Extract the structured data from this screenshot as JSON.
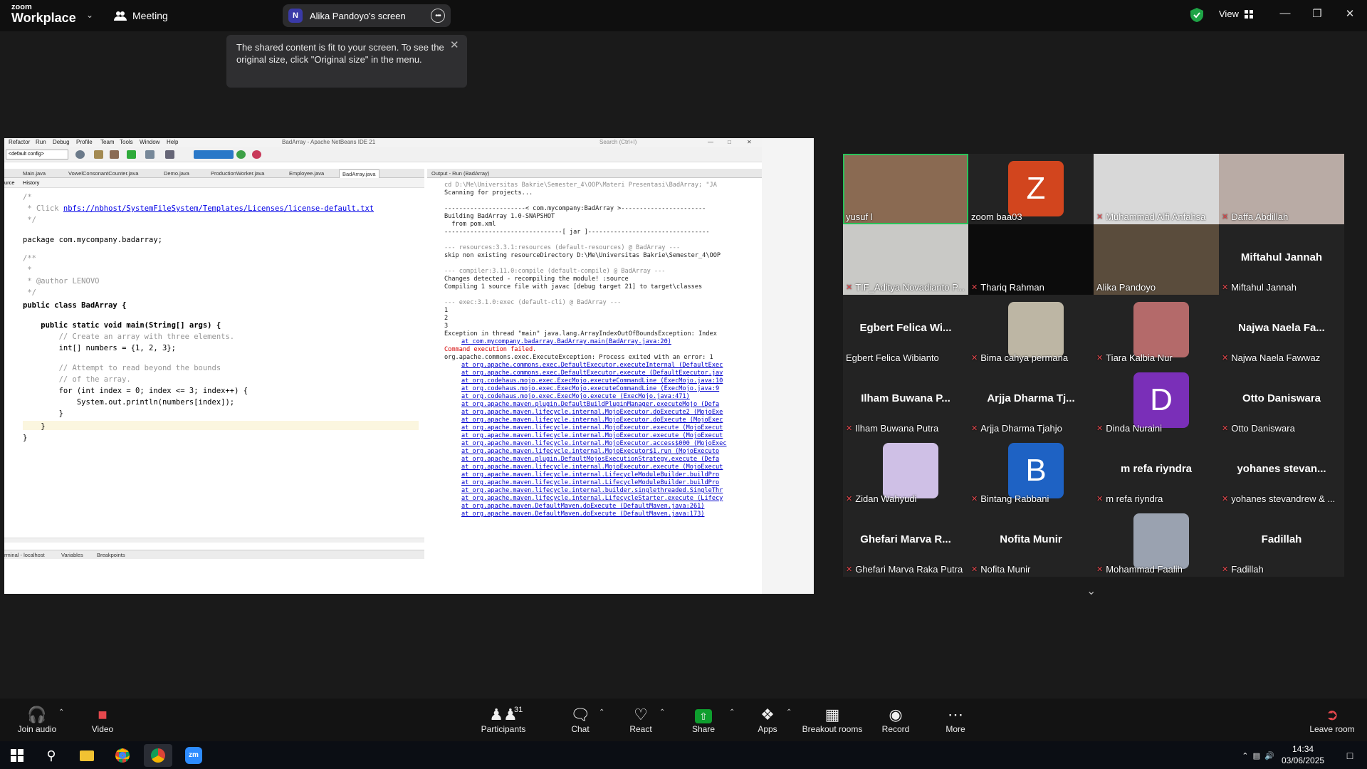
{
  "app": {
    "logo_line1": "zoom",
    "logo_line2": "Workplace",
    "meeting_label": "Meeting",
    "share_initial": "N",
    "share_title": "Alika Pandoyo's screen",
    "view_label": "View"
  },
  "toast": {
    "text": "The shared content is fit to your screen. To see the original size, click \"Original size\" in the menu."
  },
  "ide": {
    "title": "BadArray - Apache NetBeans IDE 21",
    "search_placeholder": "Search (Ctrl+I)",
    "menu": [
      "Refactor",
      "Run",
      "Debug",
      "Profile",
      "Team",
      "Tools",
      "Window",
      "Help"
    ],
    "config": "<default config>",
    "tabs": [
      "Main.java",
      "VowelConsonantCounter.java",
      "Demo.java",
      "ProductionWorker.java",
      "Employee.java",
      "BadArray.java"
    ],
    "active_tab": "BadArray.java",
    "editor_subtabs": [
      "urce",
      "History"
    ],
    "code_lines": [
      {
        "kind": "comment",
        "text": "/*"
      },
      {
        "kind": "comment-link",
        "prefix": " * Click ",
        "link": "nbfs://nbhost/SystemFileSystem/Templates/Licenses/license-default.txt"
      },
      {
        "kind": "comment",
        "text": " */"
      },
      {
        "kind": "plain",
        "text": "package com.mycompany.badarray;"
      },
      {
        "kind": "comment",
        "text": "/**"
      },
      {
        "kind": "comment",
        "text": " *"
      },
      {
        "kind": "comment",
        "text": " * @author LENOVO"
      },
      {
        "kind": "comment",
        "text": " */"
      },
      {
        "kind": "class",
        "text": "public class BadArray {"
      },
      {
        "kind": "method",
        "text": "    public static void main(String[] args) {"
      },
      {
        "kind": "comment",
        "text": "        // Create an array with three elements."
      },
      {
        "kind": "plain",
        "text": "        int[] numbers = {1, 2, 3};"
      },
      {
        "kind": "comment",
        "text": "        // Attempt to read beyond the bounds"
      },
      {
        "kind": "comment",
        "text": "        // of the array."
      },
      {
        "kind": "plain",
        "text": "        for (int index = 0; index <= 3; index++) {"
      },
      {
        "kind": "plain",
        "text": "            System.out.println(numbers[index]);"
      },
      {
        "kind": "plain",
        "text": "        }"
      },
      {
        "kind": "plain",
        "text": "    }"
      },
      {
        "kind": "plain",
        "text": "}"
      }
    ],
    "bottom_tabs": [
      "rminal - localhost",
      "Variables",
      "Breakpoints"
    ],
    "output_title": "Output - Run (BadArray)",
    "output_lines": [
      {
        "t": "g",
        "text": "cd D:\\Me\\Universitas Bakrie\\Semester_4\\OOP\\Materi Presentasi\\BadArray; \"JA"
      },
      {
        "t": "n",
        "text": "Scanning for projects..."
      },
      {
        "t": "n",
        "text": ""
      },
      {
        "t": "n",
        "text": "----------------------< com.mycompany:BadArray >-----------------------"
      },
      {
        "t": "n",
        "text": "Building BadArray 1.0-SNAPSHOT"
      },
      {
        "t": "n",
        "text": "  from pom.xml"
      },
      {
        "t": "n",
        "text": "--------------------------------[ jar ]---------------------------------"
      },
      {
        "t": "n",
        "text": ""
      },
      {
        "t": "g",
        "text": "--- resources:3.3.1:resources (default-resources) @ BadArray ---"
      },
      {
        "t": "n",
        "text": "skip non existing resourceDirectory D:\\Me\\Universitas Bakrie\\Semester_4\\OOP"
      },
      {
        "t": "n",
        "text": ""
      },
      {
        "t": "g",
        "text": "--- compiler:3.11.0:compile (default-compile) @ BadArray ---"
      },
      {
        "t": "n",
        "text": "Changes detected - recompiling the module! :source"
      },
      {
        "t": "n",
        "text": "Compiling 1 source file with javac [debug target 21] to target\\classes"
      },
      {
        "t": "n",
        "text": ""
      },
      {
        "t": "g",
        "text": "--- exec:3.1.0:exec (default-cli) @ BadArray ---"
      },
      {
        "t": "n",
        "text": "1"
      },
      {
        "t": "n",
        "text": "2"
      },
      {
        "t": "n",
        "text": "3"
      },
      {
        "t": "n",
        "text": "Exception in thread \"main\" java.lang.ArrayIndexOutOfBoundsException: Index"
      },
      {
        "t": "b",
        "text": "at com.mycompany.badarray.BadArray.main(BadArray.java:20)"
      },
      {
        "t": "r",
        "text": "Command execution failed."
      },
      {
        "t": "n",
        "text": "org.apache.commons.exec.ExecuteException: Process exited with an error: 1"
      },
      {
        "t": "b",
        "text": "at org.apache.commons.exec.DefaultExecutor.executeInternal (DefaultExec"
      },
      {
        "t": "b",
        "text": "at org.apache.commons.exec.DefaultExecutor.execute (DefaultExecutor.jav"
      },
      {
        "t": "b",
        "text": "at org.codehaus.mojo.exec.ExecMojo.executeCommandLine (ExecMojo.java:10"
      },
      {
        "t": "b",
        "text": "at org.codehaus.mojo.exec.ExecMojo.executeCommandLine (ExecMojo.java:9"
      },
      {
        "t": "b",
        "text": "at org.codehaus.mojo.exec.ExecMojo.execute (ExecMojo.java:471)"
      },
      {
        "t": "b",
        "text": "at org.apache.maven.plugin.DefaultBuildPluginManager.executeMojo (Defa"
      },
      {
        "t": "b",
        "text": "at org.apache.maven.lifecycle.internal.MojoExecutor.doExecute2 (MojoExe"
      },
      {
        "t": "b",
        "text": "at org.apache.maven.lifecycle.internal.MojoExecutor.doExecute (MojoExec"
      },
      {
        "t": "b",
        "text": "at org.apache.maven.lifecycle.internal.MojoExecutor.execute (MojoExecut"
      },
      {
        "t": "b",
        "text": "at org.apache.maven.lifecycle.internal.MojoExecutor.execute (MojoExecut"
      },
      {
        "t": "b",
        "text": "at org.apache.maven.lifecycle.internal.MojoExecutor.access$000 (MojoExec"
      },
      {
        "t": "b",
        "text": "at org.apache.maven.lifecycle.internal.MojoExecutor$1.run (MojoExecuto"
      },
      {
        "t": "b",
        "text": "at org.apache.maven.plugin.DefaultMojosExecutionStrategy.execute (Defa"
      },
      {
        "t": "b",
        "text": "at org.apache.maven.lifecycle.internal.MojoExecutor.execute (MojoExecut"
      },
      {
        "t": "b",
        "text": "at org.apache.maven.lifecycle.internal.LifecycleModuleBuilder.buildPro"
      },
      {
        "t": "b",
        "text": "at org.apache.maven.lifecycle.internal.LifecycleModuleBuilder.buildPro"
      },
      {
        "t": "b",
        "text": "at org.apache.maven.lifecycle.internal.builder.singlethreaded.SingleThr"
      },
      {
        "t": "b",
        "text": "at org.apache.maven.lifecycle.internal.LifecycleStarter.execute (Lifecy"
      },
      {
        "t": "b",
        "text": "at org.apache.maven.DefaultMaven.doExecute (DefaultMaven.java:261)"
      },
      {
        "t": "b",
        "text": "at org.apache.maven.DefaultMaven.doExecute (DefaultMaven.java:173)"
      }
    ]
  },
  "participants": [
    {
      "name": "yusuf l",
      "kind": "video",
      "muted": false,
      "active": true,
      "bg": "#8a6a52"
    },
    {
      "name": "zoom baa03",
      "kind": "avatar",
      "muted": false,
      "letter": "Z",
      "color": "#d2451e"
    },
    {
      "name": "Muhammad Alfi Anfahsa",
      "kind": "video",
      "muted": true,
      "bg": "#d8d8d8"
    },
    {
      "name": "Daffa Abdillah",
      "kind": "video",
      "muted": true,
      "bg": "#b9aba5"
    },
    {
      "name": "TIF_Aditya Novadianto P...",
      "kind": "video",
      "muted": true,
      "bg": "#c9c9c6"
    },
    {
      "name": "Thariq Rahman",
      "kind": "video",
      "muted": true,
      "bg": "#0c0c0c"
    },
    {
      "name": "Alika Pandoyo",
      "kind": "video",
      "muted": false,
      "bg": "#5a4c3c"
    },
    {
      "name": "Miftahul Jannah",
      "kind": "name",
      "muted": true,
      "big": "Miftahul Jannah"
    },
    {
      "name": "Egbert Felica Wibianto",
      "kind": "name",
      "muted": false,
      "big": "Egbert Felica Wi..."
    },
    {
      "name": "Bima cahya permana",
      "kind": "photo",
      "muted": true,
      "color": "#bdb6a4"
    },
    {
      "name": "Tiara Kalbia Nur",
      "kind": "photo",
      "muted": true,
      "color": "#b46a6a"
    },
    {
      "name": "Najwa Naela Fawwaz",
      "kind": "name",
      "muted": true,
      "big": "Najwa Naela Fa..."
    },
    {
      "name": "Ilham Buwana Putra",
      "kind": "name",
      "muted": true,
      "big": "Ilham Buwana P..."
    },
    {
      "name": "Arjja Dharma Tjahjo",
      "kind": "name",
      "muted": true,
      "big": "Arjja Dharma Tj..."
    },
    {
      "name": "Dinda Nuraini",
      "kind": "avatar",
      "muted": true,
      "letter": "D",
      "color": "#7a2fb8"
    },
    {
      "name": "Otto Daniswara",
      "kind": "name",
      "muted": true,
      "big": "Otto Daniswara"
    },
    {
      "name": "Zidan Wahyudi",
      "kind": "photo",
      "muted": true,
      "color": "#cfc0e6"
    },
    {
      "name": "Bintang Rabbani",
      "kind": "avatar",
      "muted": true,
      "letter": "B",
      "color": "#1e62c4"
    },
    {
      "name": "m refa riyndra",
      "kind": "name",
      "muted": true,
      "big": "m refa riyndra"
    },
    {
      "name": "yohanes stevandrew & ...",
      "kind": "name",
      "muted": true,
      "big": "yohanes stevan..."
    },
    {
      "name": "Ghefari Marva Raka Putra",
      "kind": "name",
      "muted": true,
      "big": "Ghefari Marva R..."
    },
    {
      "name": "Nofita Munir",
      "kind": "name",
      "muted": true,
      "big": "Nofita Munir"
    },
    {
      "name": "Mohammad Faalih",
      "kind": "photo",
      "muted": true,
      "color": "#9aa2b0"
    },
    {
      "name": "Fadillah",
      "kind": "name",
      "muted": true,
      "big": "Fadillah"
    }
  ],
  "controls": {
    "join_audio": "Join audio",
    "video": "Video",
    "participants": "Participants",
    "participants_count": "31",
    "chat": "Chat",
    "react": "React",
    "share": "Share",
    "apps": "Apps",
    "breakout": "Breakout rooms",
    "record": "Record",
    "more": "More",
    "leave": "Leave room"
  },
  "taskbar": {
    "time": "14:34",
    "date": "03/06/2025"
  },
  "colors": {
    "accent_green": "#0e9e2e",
    "active_border": "#29c35a",
    "mute_red": "#e5484d"
  }
}
